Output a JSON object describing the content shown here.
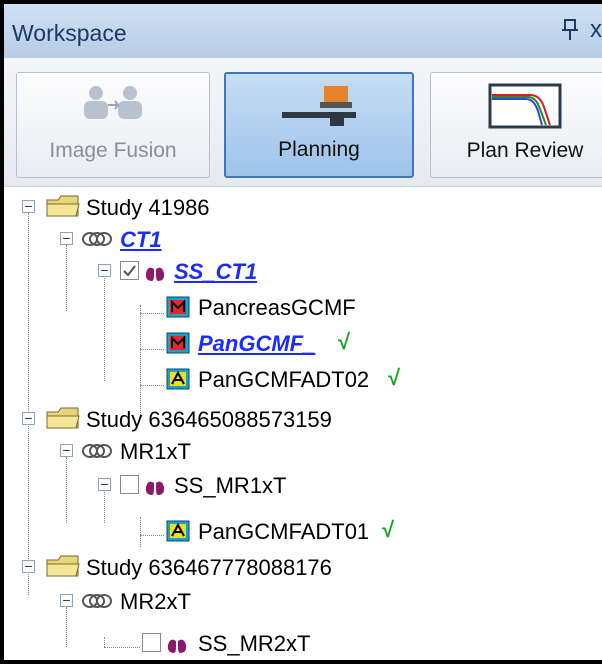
{
  "panel": {
    "title": "Workspace",
    "pin_symbol": "↕",
    "close_symbol": "x"
  },
  "toolbar": {
    "image_fusion": "Image Fusion",
    "planning": "Planning",
    "plan_review": "Plan Review"
  },
  "tree": {
    "study1": "Study 41986",
    "ct1": "CT1",
    "ss_ct1": "SS_CT1",
    "pancreas_gcmf": "PancreasGCMF",
    "pan_gcmf": "PanGCMF_",
    "pan_gcmfadt02": "PanGCMFADT02",
    "study2": "Study 636465088573159",
    "mr1xt": "MR1xT",
    "ss_mr1xt": "SS_MR1xT",
    "pan_gcmfadt01": "PanGCMFADT01",
    "study3": "Study 636467778088176",
    "mr2xt": "MR2xT",
    "ss_mr2xt": "SS_MR2xT"
  },
  "status_check_mark": "√",
  "colors": {
    "accent": "#3d78bf",
    "link": "#1a2cff",
    "check": "#1aa32a"
  }
}
